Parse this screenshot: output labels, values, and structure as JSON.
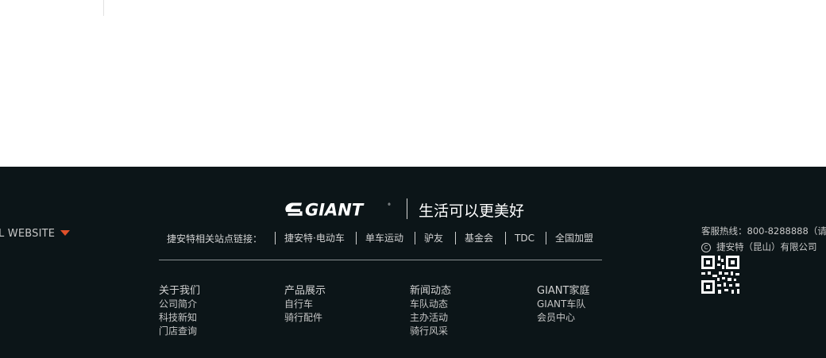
{
  "intl": {
    "label": "L WEBSITE"
  },
  "brand": {
    "logo_text": "GIANT",
    "slogan": "生活可以更美好"
  },
  "links": {
    "label": "捷安特相关站点链接：",
    "items": [
      "捷安特·电动车",
      "单车运动",
      "驴友",
      "基金会",
      "TDC",
      "全国加盟"
    ]
  },
  "columns": [
    {
      "heading": "关于我们",
      "items": [
        "公司简介",
        "科技新知",
        "门店查询"
      ]
    },
    {
      "heading": "产品展示",
      "items": [
        "自行车",
        "骑行配件"
      ]
    },
    {
      "heading": "新闻动态",
      "items": [
        "车队动态",
        "主办活动",
        "骑行风采"
      ]
    },
    {
      "heading": "GIANT家庭",
      "items": [
        "GIANT车队",
        "会员中心"
      ]
    }
  ],
  "contact": {
    "hotline": "客服热线：800-8288888（请",
    "copyright_symbol": "C",
    "company": "捷安特（昆山）有限公司"
  },
  "colors": {
    "footer_bg": "#0c1518",
    "accent": "#e0502a"
  }
}
